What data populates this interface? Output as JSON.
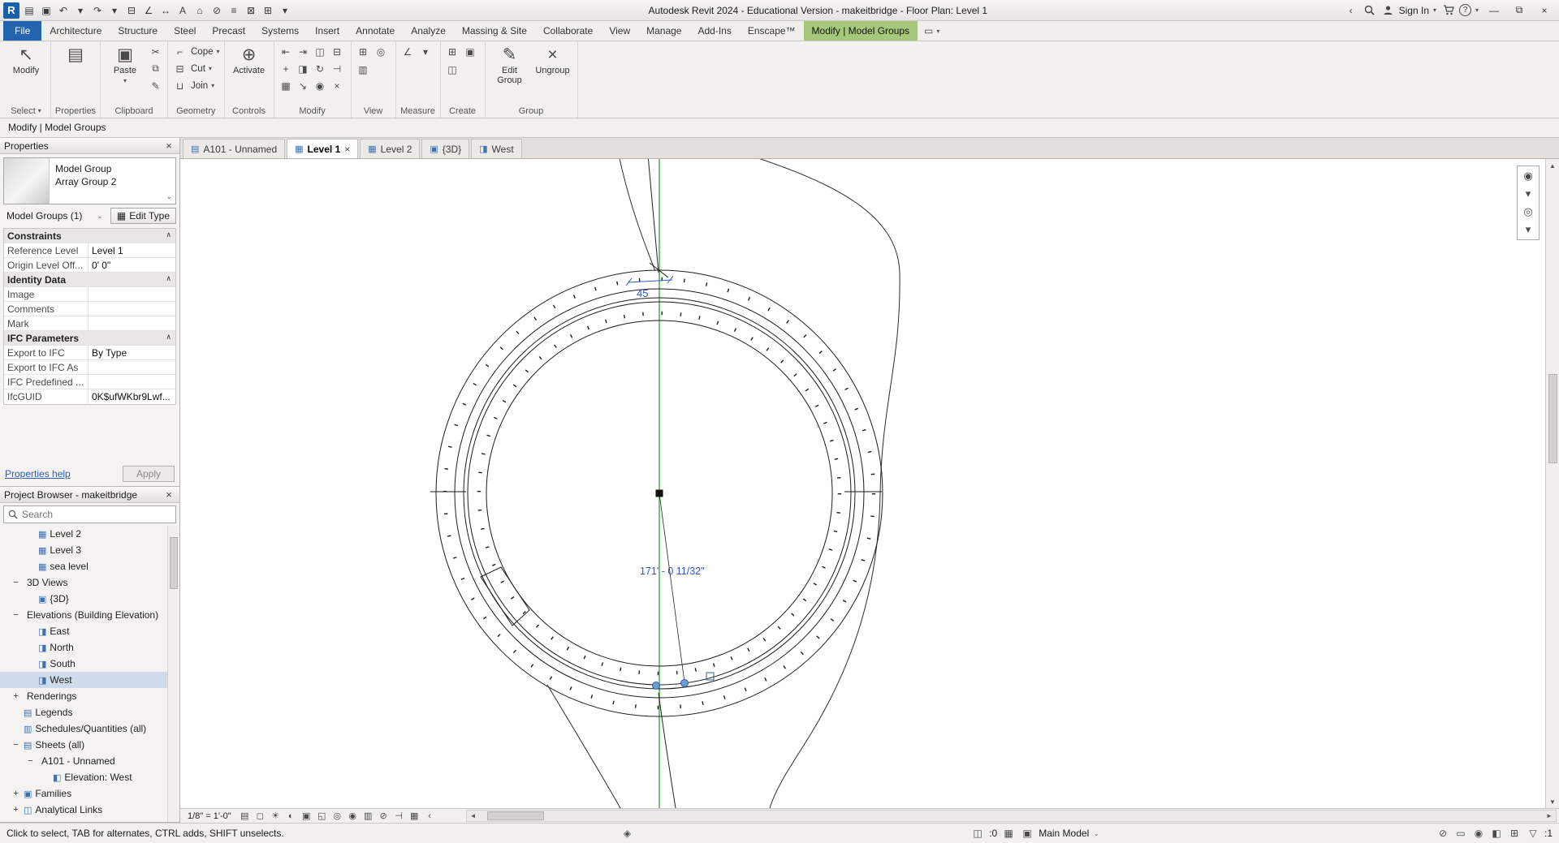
{
  "ui": {
    "caret": "▾",
    "caret_down": "⌄"
  },
  "colors": {
    "contextual_tab_green": "#a6c87b",
    "file_tab_blue": "#2463ad",
    "centerline_green": "#2da12d",
    "dimension_blue": "#3056c8",
    "selection_blue": "#5b8bd0"
  },
  "titlebar": {
    "logo_text": "R",
    "title": "Autodesk Revit 2024 - Educational Version - makeitbridge - Floor Plan: Level 1",
    "collapse_glyph": "‹",
    "sign_in_label": "Sign In",
    "help_glyph": "?",
    "window": {
      "minimize": "—",
      "restore": "⧉",
      "close": "×"
    },
    "qat": [
      {
        "name": "open-icon",
        "glyph": "▤"
      },
      {
        "name": "save-icon",
        "glyph": "▣"
      },
      {
        "name": "undo-icon",
        "glyph": "↶"
      },
      {
        "name": "undo-menu-icon",
        "glyph": "▾"
      },
      {
        "name": "redo-icon",
        "glyph": "↷"
      },
      {
        "name": "redo-menu-icon",
        "glyph": "▾"
      },
      {
        "name": "print-icon",
        "glyph": "⊟"
      },
      {
        "name": "measure-icon",
        "glyph": "∠"
      },
      {
        "name": "aligned-dimension-icon",
        "glyph": "↔"
      },
      {
        "name": "text-icon",
        "glyph": "A"
      },
      {
        "name": "default-3d-view-icon",
        "glyph": "⌂"
      },
      {
        "name": "section-icon",
        "glyph": "⊘"
      },
      {
        "name": "thin-lines-icon",
        "glyph": "≡"
      },
      {
        "name": "close-hidden-windows-icon",
        "glyph": "⊠"
      },
      {
        "name": "switch-windows-icon",
        "glyph": "⊞"
      },
      {
        "name": "customize-qat-icon",
        "glyph": "▾"
      }
    ]
  },
  "ribbon": {
    "tab_options_glyph": "▭",
    "tabs": [
      {
        "label": "File",
        "state": "file"
      },
      {
        "label": "Architecture"
      },
      {
        "label": "Structure"
      },
      {
        "label": "Steel"
      },
      {
        "label": "Precast"
      },
      {
        "label": "Systems"
      },
      {
        "label": "Insert"
      },
      {
        "label": "Annotate"
      },
      {
        "label": "Analyze"
      },
      {
        "label": "Massing & Site"
      },
      {
        "label": "Collaborate"
      },
      {
        "label": "View"
      },
      {
        "label": "Manage"
      },
      {
        "label": "Add-Ins"
      },
      {
        "label": "Enscape™"
      },
      {
        "label": "Modify | Model Groups",
        "state": "contextual"
      }
    ],
    "panels": {
      "select": {
        "button_glyph": "↖",
        "button_label": "Modify",
        "panel_label": "Select"
      },
      "properties": {
        "button_glyph": "▤",
        "button_label": "",
        "panel_label": "Properties"
      },
      "clipboard": {
        "button_glyph": "▣",
        "button_label": "Paste",
        "panel_label": "Clipboard",
        "small_icons": [
          {
            "name": "cut-to-clipboard-icon",
            "glyph": "✂"
          },
          {
            "name": "copy-to-clipboard-icon",
            "glyph": "⧉"
          },
          {
            "name": "match-type-icon",
            "glyph": "✎"
          }
        ]
      },
      "geometry": {
        "panel_label": "Geometry",
        "items": [
          {
            "name": "cope-button",
            "glyph": "⌐",
            "label": "Cope"
          },
          {
            "name": "cut-geometry-button",
            "glyph": "⊟",
            "label": "Cut"
          },
          {
            "name": "join-geometry-button",
            "glyph": "⊔",
            "label": "Join"
          }
        ]
      },
      "controls": {
        "button_glyph": "⊕",
        "button_label": "Activate",
        "panel_label": "Controls"
      },
      "modify": {
        "panel_label": "Modify",
        "icons": [
          {
            "name": "align-icon",
            "glyph": "⇤"
          },
          {
            "name": "offset-icon",
            "glyph": "⇥"
          },
          {
            "name": "mirror-axis-icon",
            "glyph": "◫"
          },
          {
            "name": "split-icon",
            "glyph": "⊟"
          },
          {
            "name": "move-icon",
            "glyph": "+",
            "tone": "b"
          },
          {
            "name": "copy-icon",
            "glyph": "◨"
          },
          {
            "name": "rotate-icon",
            "glyph": "↻"
          },
          {
            "name": "trim-extend-icon",
            "glyph": "⊣"
          },
          {
            "name": "array-icon",
            "glyph": "▦"
          },
          {
            "name": "scale-icon",
            "glyph": "↘"
          },
          {
            "name": "pin-icon",
            "glyph": "◉",
            "tone": "b"
          },
          {
            "name": "delete-icon",
            "glyph": "×",
            "tone": "r"
          }
        ]
      },
      "view": {
        "panel_label": "View",
        "icons": [
          {
            "name": "selection-box-icon",
            "glyph": "⊞",
            "tone": "b"
          },
          {
            "name": "hide-elements-icon",
            "glyph": "◎"
          },
          {
            "name": "override-graphics-icon",
            "glyph": "▥"
          }
        ]
      },
      "measure": {
        "panel_label": "Measure",
        "icons": [
          {
            "name": "measure-tool-icon",
            "glyph": "∠",
            "tone": "b"
          },
          {
            "name": "measure-menu-icon",
            "glyph": "▾"
          }
        ]
      },
      "create": {
        "panel_label": "Create",
        "icons": [
          {
            "name": "create-similar-icon",
            "glyph": "⊞"
          },
          {
            "name": "create-group-icon",
            "glyph": "▣"
          },
          {
            "name": "create-assembly-icon",
            "glyph": "◫"
          }
        ]
      },
      "group": {
        "edit_glyph": "✎",
        "edit_label": "Edit Group",
        "ungroup_glyph": "×",
        "ungroup_label": "Ungroup",
        "panel_label": "Group"
      }
    }
  },
  "options_bar": {
    "label": "Modify | Model Groups"
  },
  "properties": {
    "title": "Properties",
    "close_glyph": "×",
    "type_line1": "Model Group",
    "type_line2": "Array Group 2",
    "filter_label": "Model Groups (1)",
    "edit_type_glyph": "▦",
    "edit_type_label": "Edit Type",
    "rows": [
      {
        "state": "section",
        "label": "Constraints",
        "value": ""
      },
      {
        "label": "Reference Level",
        "value": "Level 1"
      },
      {
        "label": "Origin Level Off...",
        "value": "0' 0\""
      },
      {
        "state": "section",
        "label": "Identity Data",
        "value": ""
      },
      {
        "label": "Image",
        "value": ""
      },
      {
        "label": "Comments",
        "value": ""
      },
      {
        "label": "Mark",
        "value": ""
      },
      {
        "state": "section",
        "label": "IFC Parameters",
        "value": ""
      },
      {
        "label": "Export to IFC",
        "value": "By Type"
      },
      {
        "label": "Export to IFC As",
        "value": ""
      },
      {
        "label": "IFC Predefined ...",
        "value": ""
      },
      {
        "label": "IfcGUID",
        "value": "0K$ufWKbr9Lwf..."
      }
    ],
    "help_label": "Properties help",
    "apply_label": "Apply"
  },
  "project_browser": {
    "title": "Project Browser - makeitbridge",
    "close_glyph": "×",
    "search_placeholder": "Search",
    "items": [
      {
        "indent": 3,
        "icon": "floor-plan-icon",
        "glyph": "▦",
        "label": "Level 2"
      },
      {
        "indent": 3,
        "icon": "floor-plan-icon",
        "glyph": "▦",
        "label": "Level 3"
      },
      {
        "indent": 3,
        "icon": "floor-plan-icon",
        "glyph": "▦",
        "label": "sea level"
      },
      {
        "indent": 2,
        "expander": "−",
        "label": "3D Views"
      },
      {
        "indent": 3,
        "icon": "view-3d-icon",
        "glyph": "▣",
        "label": "{3D}"
      },
      {
        "indent": 2,
        "expander": "−",
        "label": "Elevations (Building Elevation)"
      },
      {
        "indent": 3,
        "icon": "elevation-icon",
        "glyph": "◨",
        "label": "East"
      },
      {
        "indent": 3,
        "icon": "elevation-icon",
        "glyph": "◨",
        "label": "North"
      },
      {
        "indent": 3,
        "icon": "elevation-icon",
        "glyph": "◨",
        "label": "South"
      },
      {
        "indent": 3,
        "icon": "elevation-icon",
        "glyph": "◨",
        "label": "West",
        "state": "selected"
      },
      {
        "indent": 2,
        "expander": "+",
        "label": "Renderings"
      },
      {
        "indent": 2,
        "icon": "legends-icon",
        "glyph": "▤",
        "label": "Legends"
      },
      {
        "indent": 2,
        "icon": "schedules-icon",
        "glyph": "▥",
        "label": "Schedules/Quantities (all)"
      },
      {
        "indent": 2,
        "expander": "−",
        "icon": "sheets-icon",
        "glyph": "▤",
        "label": "Sheets (all)"
      },
      {
        "indent": 3,
        "expander": "−",
        "label": "A101 - Unnamed"
      },
      {
        "indent": 4,
        "icon": "sheet-view-icon",
        "glyph": "◧",
        "label": "Elevation: West"
      },
      {
        "indent": 2,
        "expander": "+",
        "icon": "families-icon",
        "glyph": "▣",
        "label": "Families"
      },
      {
        "indent": 2,
        "expander": "+",
        "icon": "links-icon",
        "glyph": "◫",
        "label": "Analytical Links"
      }
    ]
  },
  "view_tabs": [
    {
      "label": "A101 - Unnamed",
      "icon": "sheet-icon",
      "glyph": "▤"
    },
    {
      "label": "Level 1",
      "icon": "floor-plan-icon",
      "glyph": "▦",
      "state": "active",
      "close": "×"
    },
    {
      "label": "Level 2",
      "icon": "floor-plan-icon",
      "glyph": "▦"
    },
    {
      "label": "{3D}",
      "icon": "view-3d-icon",
      "glyph": "▣"
    },
    {
      "label": "West",
      "icon": "elevation-icon",
      "glyph": "◨"
    }
  ],
  "canvas": {
    "dim_top": "45",
    "dim_radius": "171' - 0 11/32\"",
    "nav": [
      {
        "name": "steering-wheel-icon",
        "glyph": "◉"
      },
      {
        "name": "steering-wheel-menu-icon",
        "glyph": "▾"
      },
      {
        "name": "zoom-icon",
        "glyph": "◎"
      },
      {
        "name": "zoom-menu-icon",
        "glyph": "▾"
      }
    ]
  },
  "scrollbars": {
    "up": "▲",
    "down": "▼",
    "left": "◄",
    "right": "►"
  },
  "view_control": {
    "scale": "1/8\" = 1'-0\"",
    "collapse_glyph": "‹",
    "icons": [
      {
        "name": "detail-level-icon",
        "glyph": "▤"
      },
      {
        "name": "visual-style-icon",
        "glyph": "◻"
      },
      {
        "name": "sun-path-icon",
        "glyph": "☀",
        "tone": "y"
      },
      {
        "name": "shadows-icon",
        "glyph": "◐"
      },
      {
        "name": "crop-view-icon",
        "glyph": "▣"
      },
      {
        "name": "show-crop-icon",
        "glyph": "◱"
      },
      {
        "name": "temporary-hide-icon",
        "glyph": "◎",
        "tone": "b"
      },
      {
        "name": "reveal-hidden-icon",
        "glyph": "◉",
        "tone": "r"
      },
      {
        "name": "temporary-view-properties-icon",
        "glyph": "▥"
      },
      {
        "name": "show-analytical-icon",
        "glyph": "⊘",
        "tone": "g"
      },
      {
        "name": "reveal-constraints-icon",
        "glyph": "⊣",
        "tone": "r"
      },
      {
        "name": "worksharing-display-icon",
        "glyph": "▦"
      }
    ]
  },
  "status_bar": {
    "message": "Click to select, TAB for alternates, CTRL adds, SHIFT unselects.",
    "performance_glyph": "◈",
    "editable_glyph": "◫",
    "editable_count": ":0",
    "worksets_glyph": "▦",
    "design_options_glyph": "▣",
    "main_model": "Main Model",
    "right_icons": [
      {
        "name": "select-links-icon",
        "glyph": "⊘"
      },
      {
        "name": "select-underlay-icon",
        "glyph": "▭"
      },
      {
        "name": "select-pinned-icon",
        "glyph": "◉"
      },
      {
        "name": "select-by-face-icon",
        "glyph": "◧"
      },
      {
        "name": "drag-on-selection-icon",
        "glyph": "⊞"
      }
    ],
    "filter_glyph": "▽",
    "filter_count": ":1"
  }
}
